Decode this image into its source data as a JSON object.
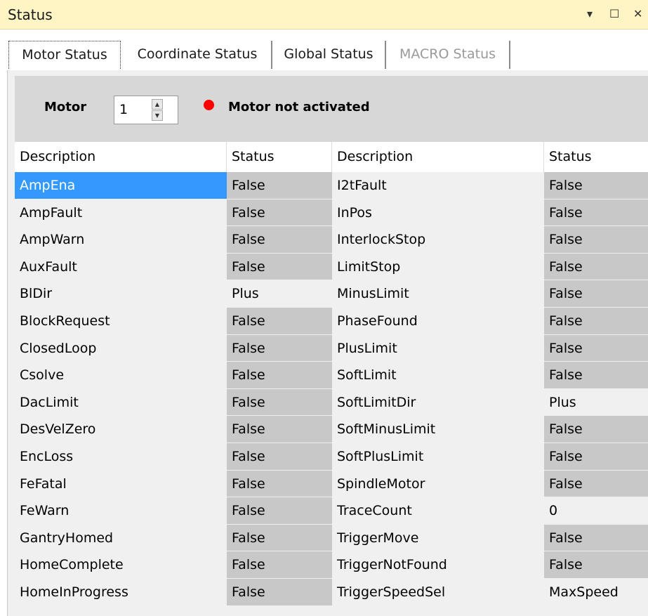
{
  "window": {
    "title": "Status",
    "controls": {
      "dropdown": "▾",
      "restore": "☐",
      "close": "✕"
    }
  },
  "tabs": [
    {
      "label": "Motor Status",
      "active": true,
      "enabled": true
    },
    {
      "label": "Coordinate Status",
      "active": false,
      "enabled": true
    },
    {
      "label": "Global Status",
      "active": false,
      "enabled": true
    },
    {
      "label": "MACRO Status",
      "active": false,
      "enabled": false
    }
  ],
  "motor": {
    "label": "Motor",
    "number": "1",
    "indicator_color": "#ff0000",
    "message": "Motor not activated"
  },
  "table": {
    "headers": [
      "Description",
      "Status",
      "Description",
      "Status"
    ],
    "selected_cell": "AmpEna",
    "rows": [
      {
        "d1": "AmpEna",
        "s1": "False",
        "d2": "I2tFault",
        "s2": "False"
      },
      {
        "d1": "AmpFault",
        "s1": "False",
        "d2": "InPos",
        "s2": "False"
      },
      {
        "d1": "AmpWarn",
        "s1": "False",
        "d2": "InterlockStop",
        "s2": "False"
      },
      {
        "d1": "AuxFault",
        "s1": "False",
        "d2": "LimitStop",
        "s2": "False"
      },
      {
        "d1": "BlDir",
        "s1": "Plus",
        "d2": "MinusLimit",
        "s2": "False"
      },
      {
        "d1": "BlockRequest",
        "s1": "False",
        "d2": "PhaseFound",
        "s2": "False"
      },
      {
        "d1": "ClosedLoop",
        "s1": "False",
        "d2": "PlusLimit",
        "s2": "False"
      },
      {
        "d1": "Csolve",
        "s1": "False",
        "d2": "SoftLimit",
        "s2": "False"
      },
      {
        "d1": "DacLimit",
        "s1": "False",
        "d2": "SoftLimitDir",
        "s2": "Plus"
      },
      {
        "d1": "DesVelZero",
        "s1": "False",
        "d2": "SoftMinusLimit",
        "s2": "False"
      },
      {
        "d1": "EncLoss",
        "s1": "False",
        "d2": "SoftPlusLimit",
        "s2": "False"
      },
      {
        "d1": "FeFatal",
        "s1": "False",
        "d2": "SpindleMotor",
        "s2": "False"
      },
      {
        "d1": "FeWarn",
        "s1": "False",
        "d2": "TraceCount",
        "s2": "0"
      },
      {
        "d1": "GantryHomed",
        "s1": "False",
        "d2": "TriggerMove",
        "s2": "False"
      },
      {
        "d1": "HomeComplete",
        "s1": "False",
        "d2": "TriggerNotFound",
        "s2": "False"
      },
      {
        "d1": "HomeInProgress",
        "s1": "False",
        "d2": "TriggerSpeedSel",
        "s2": "MaxSpeed"
      }
    ]
  }
}
